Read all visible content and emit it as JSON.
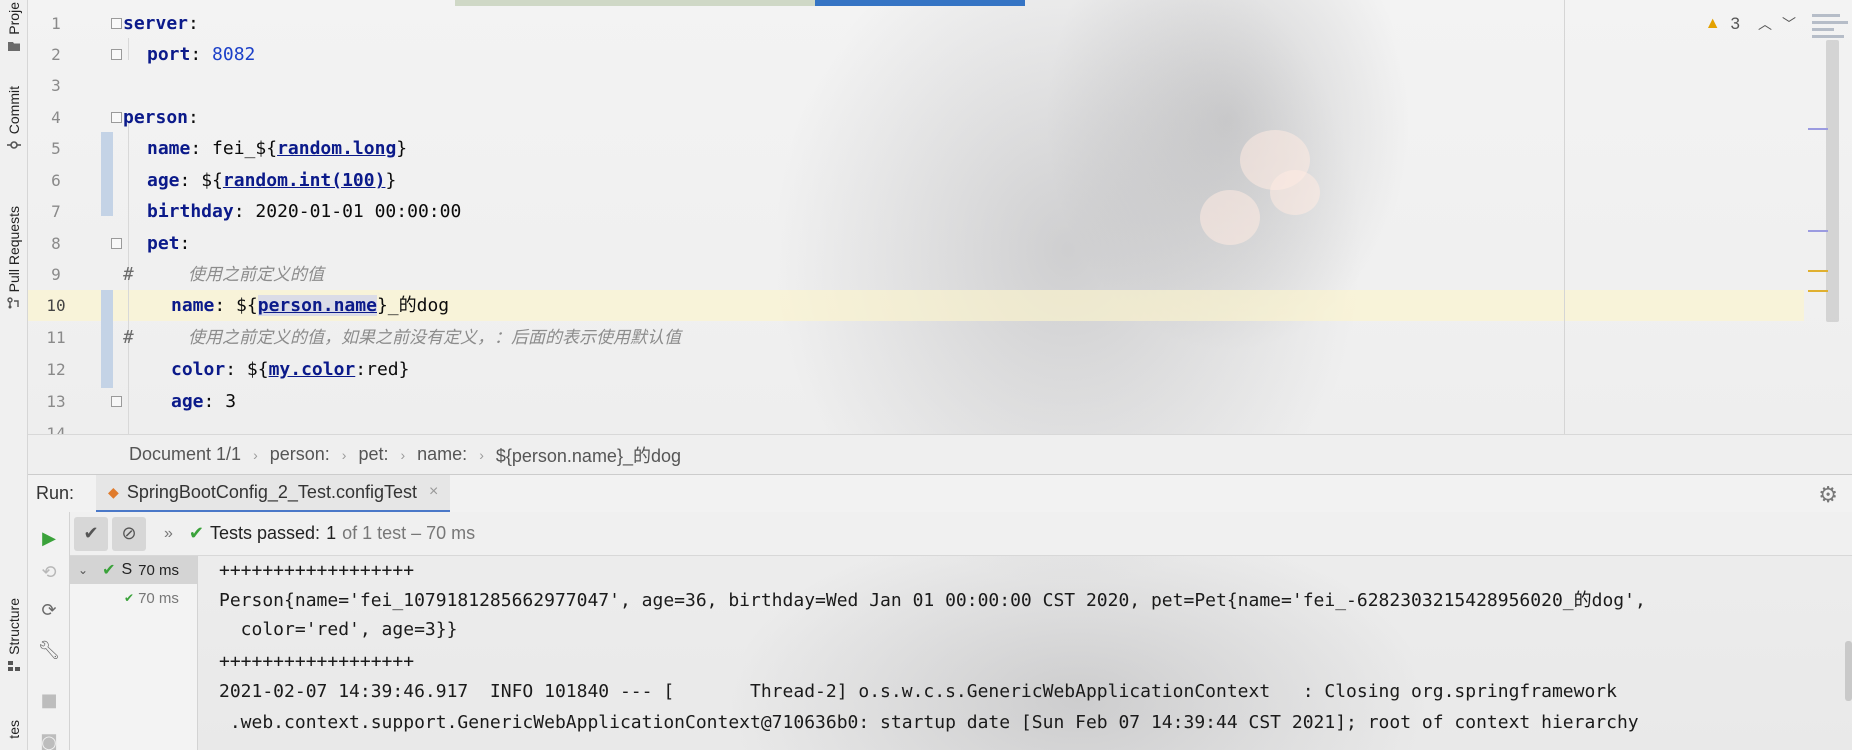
{
  "left_strip": {
    "project_label": "Proje",
    "commit_label": "Commit",
    "pull_requests_label": "Pull Requests",
    "structure_label": "Structure",
    "favorites_label": "tes"
  },
  "editor": {
    "warning_count": "3",
    "lines": [
      {
        "n": "1"
      },
      {
        "n": "2"
      },
      {
        "n": "3"
      },
      {
        "n": "4"
      },
      {
        "n": "5"
      },
      {
        "n": "6"
      },
      {
        "n": "7"
      },
      {
        "n": "8"
      },
      {
        "n": "9"
      },
      {
        "n": "10"
      },
      {
        "n": "11"
      },
      {
        "n": "12"
      },
      {
        "n": "13"
      },
      {
        "n": "14"
      }
    ],
    "code": {
      "l1_key": "server",
      "l2_key": "port",
      "l2_val": "8082",
      "l4_key": "person",
      "l5_key": "name",
      "l5_pre": "fei_${",
      "l5_ref": "random.long",
      "l5_post": "}",
      "l6_key": "age",
      "l6_pre": "${",
      "l6_ref": "random.int(100)",
      "l6_post": "}",
      "l7_key": "birthday",
      "l7_val": "2020-01-01 00:00:00",
      "l8_key": "pet",
      "l9_hash": "#",
      "l9_comment": "使用之前定义的值",
      "l10_key": "name",
      "l10_pre": "${",
      "l10_ref": "person.name",
      "l10_post": "}_的dog",
      "l11_hash": "#",
      "l11_comment": "使用之前定义的值，如果之前没有定义，：后面的表示使用默认值",
      "l12_key": "color",
      "l12_pre": "${",
      "l12_ref": "my.color",
      "l12_post": ":red}",
      "l13_key": "age",
      "l13_val": "3"
    }
  },
  "breadcrumb": {
    "items": [
      "Document 1/1",
      "person:",
      "pet:",
      "name:",
      "${person.name}_的dog"
    ]
  },
  "run": {
    "label": "Run:",
    "tab_title": "SpringBootConfig_2_Test.configTest",
    "tests_passed_label": "Tests passed:",
    "tests_passed_count": "1",
    "tests_passed_rest": "of 1 test – 70 ms",
    "tree": {
      "root_label": "S",
      "root_time": "70 ms",
      "child_time": "70 ms"
    },
    "console": [
      "++++++++++++++++++",
      "Person{name='fei_1079181285662977047', age=36, birthday=Wed Jan 01 00:00:00 CST 2020, pet=Pet{name='fei_-6282303215428956020_的dog',",
      "  color='red', age=3}}",
      "++++++++++++++++++",
      "2021-02-07 14:39:46.917  INFO 101840 --- [       Thread-2] o.s.w.c.s.GenericWebApplicationContext   : Closing org.springframework",
      " .web.context.support.GenericWebApplicationContext@710636b0: startup date [Sun Feb 07 14:39:44 CST 2021]; root of context hierarchy"
    ]
  }
}
